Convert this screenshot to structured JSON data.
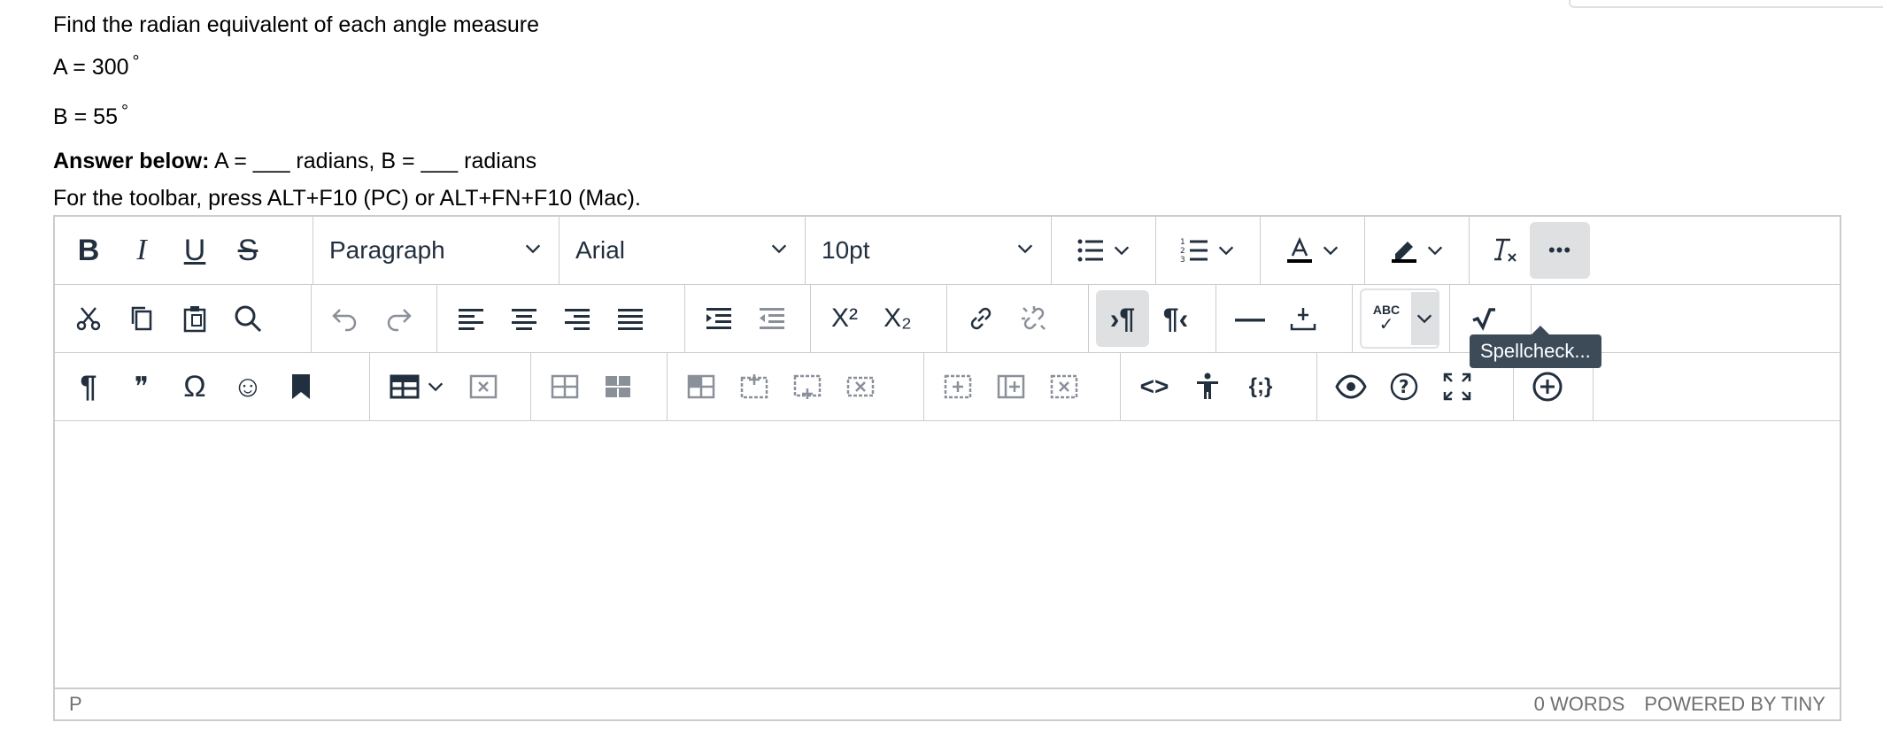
{
  "question": {
    "line1": "Find the radian equivalent of each angle measure",
    "line2": "A = 300",
    "line3": "B = 55",
    "degree_symbol": "°",
    "answer_bold": "Answer below:",
    "answer_rest": " A = ___ radians, B = ___ radians"
  },
  "hint": "For the toolbar, press ALT+F10 (PC) or ALT+FN+F10 (Mac).",
  "toolbar": {
    "block_format": "Paragraph",
    "font_family": "Arial",
    "font_size": "10pt",
    "more_label": "•••",
    "tooltip": "Spellcheck..."
  },
  "statusbar": {
    "path": "P",
    "word_count": "0 WORDS",
    "branding": "POWERED BY TINY"
  },
  "icons": {
    "bold": "B",
    "italic": "I",
    "underline": "U",
    "strike": "S",
    "paragraph": "¶",
    "quote": "❞",
    "omega": "Ω",
    "emoji": "☺",
    "code": "<>",
    "codesample": "{;}",
    "help": "?",
    "superscript": "X²",
    "subscript": "X₂",
    "ltr": "›¶",
    "rtl": "¶‹",
    "hr": "—",
    "abc": "ABC",
    "clear": "Tx"
  }
}
